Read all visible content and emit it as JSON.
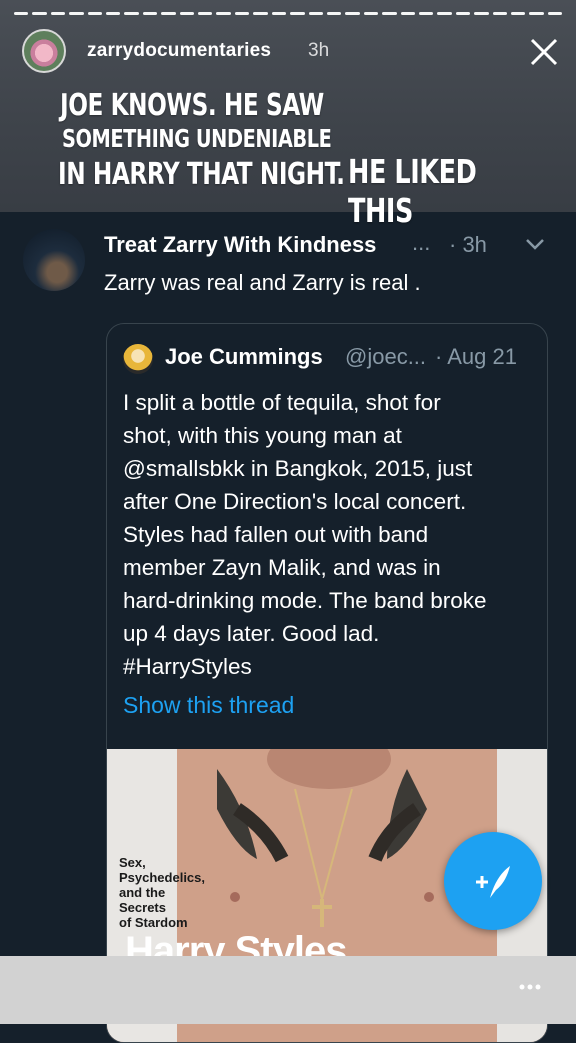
{
  "story": {
    "username": "zarrydocumentaries",
    "time": "3h",
    "captions": [
      "JOE KNOWS. HE SAW",
      "SOMETHING UNDENIABLE",
      "IN HARRY THAT NIGHT.",
      "HE LIKED THIS"
    ],
    "progress_segments": 30,
    "current_segment": 29
  },
  "reply": {
    "name": "Treat Zarry With Kindness",
    "ellipsis": "...",
    "time": "· 3h",
    "text": "Zarry was real and Zarry is real ."
  },
  "quote": {
    "name": "Joe Cummings",
    "handle": "@joec...",
    "date": "· Aug 21",
    "lines": [
      "I split a bottle of tequila, shot for",
      "shot, with this young man at",
      "@smallsbkk in Bangkok, 2015, just",
      "after One Direction's local concert.",
      "Styles had fallen out with band",
      "member Zayn Malik, and was in",
      "hard-drinking mode. The band broke",
      "up 4 days later. Good lad.",
      "#HarryStyles"
    ],
    "show_thread": "Show this thread",
    "image": {
      "cover_lines": [
        "Sex,",
        "Psychedelics,",
        "and the",
        "Secrets",
        "of Stardom"
      ],
      "cover_title": "Harry Styles"
    }
  },
  "icons": {
    "close": "close-icon",
    "chevron": "chevron-down-icon",
    "compose": "compose-tweet-icon",
    "more": "more-icon"
  },
  "colors": {
    "background": "#15202b",
    "accent": "#1da1f2",
    "muted": "#8899a6"
  }
}
